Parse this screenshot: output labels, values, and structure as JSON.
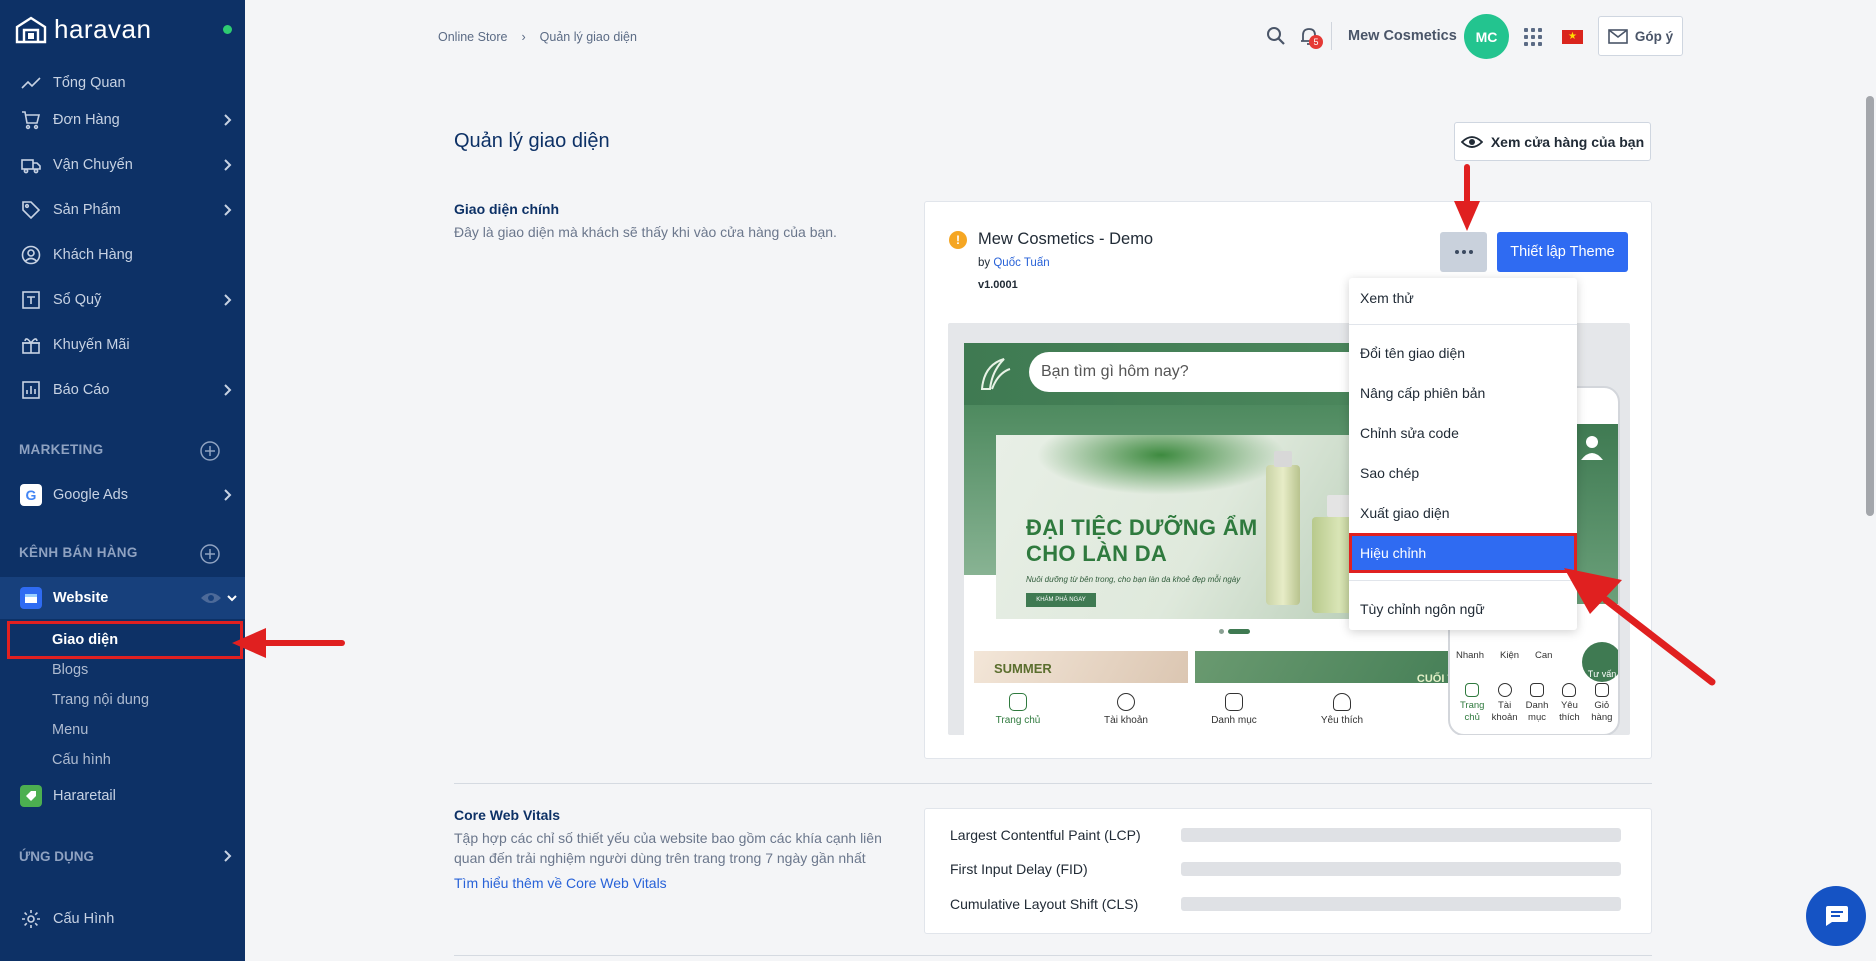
{
  "brand": {
    "name": "haravan"
  },
  "sidebar": {
    "items": [
      {
        "label": "Tổng Quan",
        "icon": "trend-icon",
        "chevron": false
      },
      {
        "label": "Đơn Hàng",
        "icon": "cart-icon",
        "chevron": true
      },
      {
        "label": "Vận Chuyển",
        "icon": "truck-icon",
        "chevron": true
      },
      {
        "label": "Sản Phẩm",
        "icon": "tag-icon",
        "chevron": true
      },
      {
        "label": "Khách Hàng",
        "icon": "user-circle-icon",
        "chevron": false
      },
      {
        "label": "Sổ Quỹ",
        "icon": "cashbook-icon",
        "chevron": true
      },
      {
        "label": "Khuyến Mãi",
        "icon": "gift-icon",
        "chevron": false
      },
      {
        "label": "Báo Cáo",
        "icon": "report-icon",
        "chevron": true
      }
    ],
    "marketing_label": "MARKETING",
    "google_ads_label": "Google Ads",
    "channels_label": "KÊNH BÁN HÀNG",
    "website_label": "Website",
    "website_sub": [
      "Giao diện",
      "Blogs",
      "Trang nội dung",
      "Menu",
      "Cấu hình"
    ],
    "hararetail_label": "Hararetail",
    "apps_label": "ỨNG DỤNG",
    "settings_label": "Cấu Hình"
  },
  "header": {
    "breadcrumb": [
      "Online Store",
      "Quản lý giao diện"
    ],
    "bell_count": "5",
    "store_name": "Mew Cosmetics",
    "avatar_initials": "MC",
    "feedback_label": "Góp ý"
  },
  "main": {
    "title": "Quản lý giao diện",
    "view_store_label": "Xem cửa hàng của bạn",
    "main_theme": {
      "title": "Giao diện chính",
      "description": "Đây là giao diện mà khách sẽ thấy khi vào cửa hàng của bạn.",
      "name": "Mew Cosmetics - Demo",
      "by_prefix": "by",
      "author": "Quốc Tuấn",
      "version": "v1.0001",
      "setup_label": "Thiết lập Theme"
    },
    "dropdown": [
      "Xem thử",
      "Đổi tên giao diện",
      "Nâng cấp phiên bản",
      "Chỉnh sửa code",
      "Sao chép",
      "Xuất giao diện",
      "Hiệu chỉnh",
      "Tùy chỉnh ngôn ngữ"
    ],
    "preview": {
      "search_placeholder": "Bạn tìm gì hôm nay?",
      "headline_1": "ĐẠI TIỆC DƯỠNG ẨM",
      "headline_2": "CHO LÀN DA",
      "subline": "Nuôi dưỡng từ bên trong, cho bạn làn da khoẻ đẹp mỗi ngày",
      "cta": "KHÁM PHÁ NGAY",
      "tile1": "SUMMER",
      "tile2": "CUỐI TUẦN",
      "desktop_nav": [
        "Trang chủ",
        "Tài khoản",
        "Danh mục",
        "Yêu thích"
      ],
      "phone_circle_labels": [
        "Nhanh",
        "Kiện",
        "Can"
      ],
      "phone_chat": "Tư vấn",
      "phone_nav": [
        "Trang chủ",
        "Tài khoản",
        "Danh mục",
        "Yêu thích",
        "Giỏ hàng"
      ]
    },
    "cwv": {
      "title": "Core Web Vitals",
      "description": "Tập hợp các chỉ số thiết yếu của website bao gồm các khía cạnh liên quan đến trải nghiệm người dùng trên trang trong 7 ngày gần nhất",
      "link": "Tìm hiểu thêm về Core Web Vitals",
      "metrics": [
        "Largest Contentful Paint (LCP)",
        "First Input Delay (FID)",
        "Cumulative Layout Shift (CLS)"
      ]
    }
  },
  "colors": {
    "sidebar": "#0d3166",
    "primary": "#2f6bf2",
    "annotation": "#e02020",
    "avatar": "#23c48f"
  }
}
